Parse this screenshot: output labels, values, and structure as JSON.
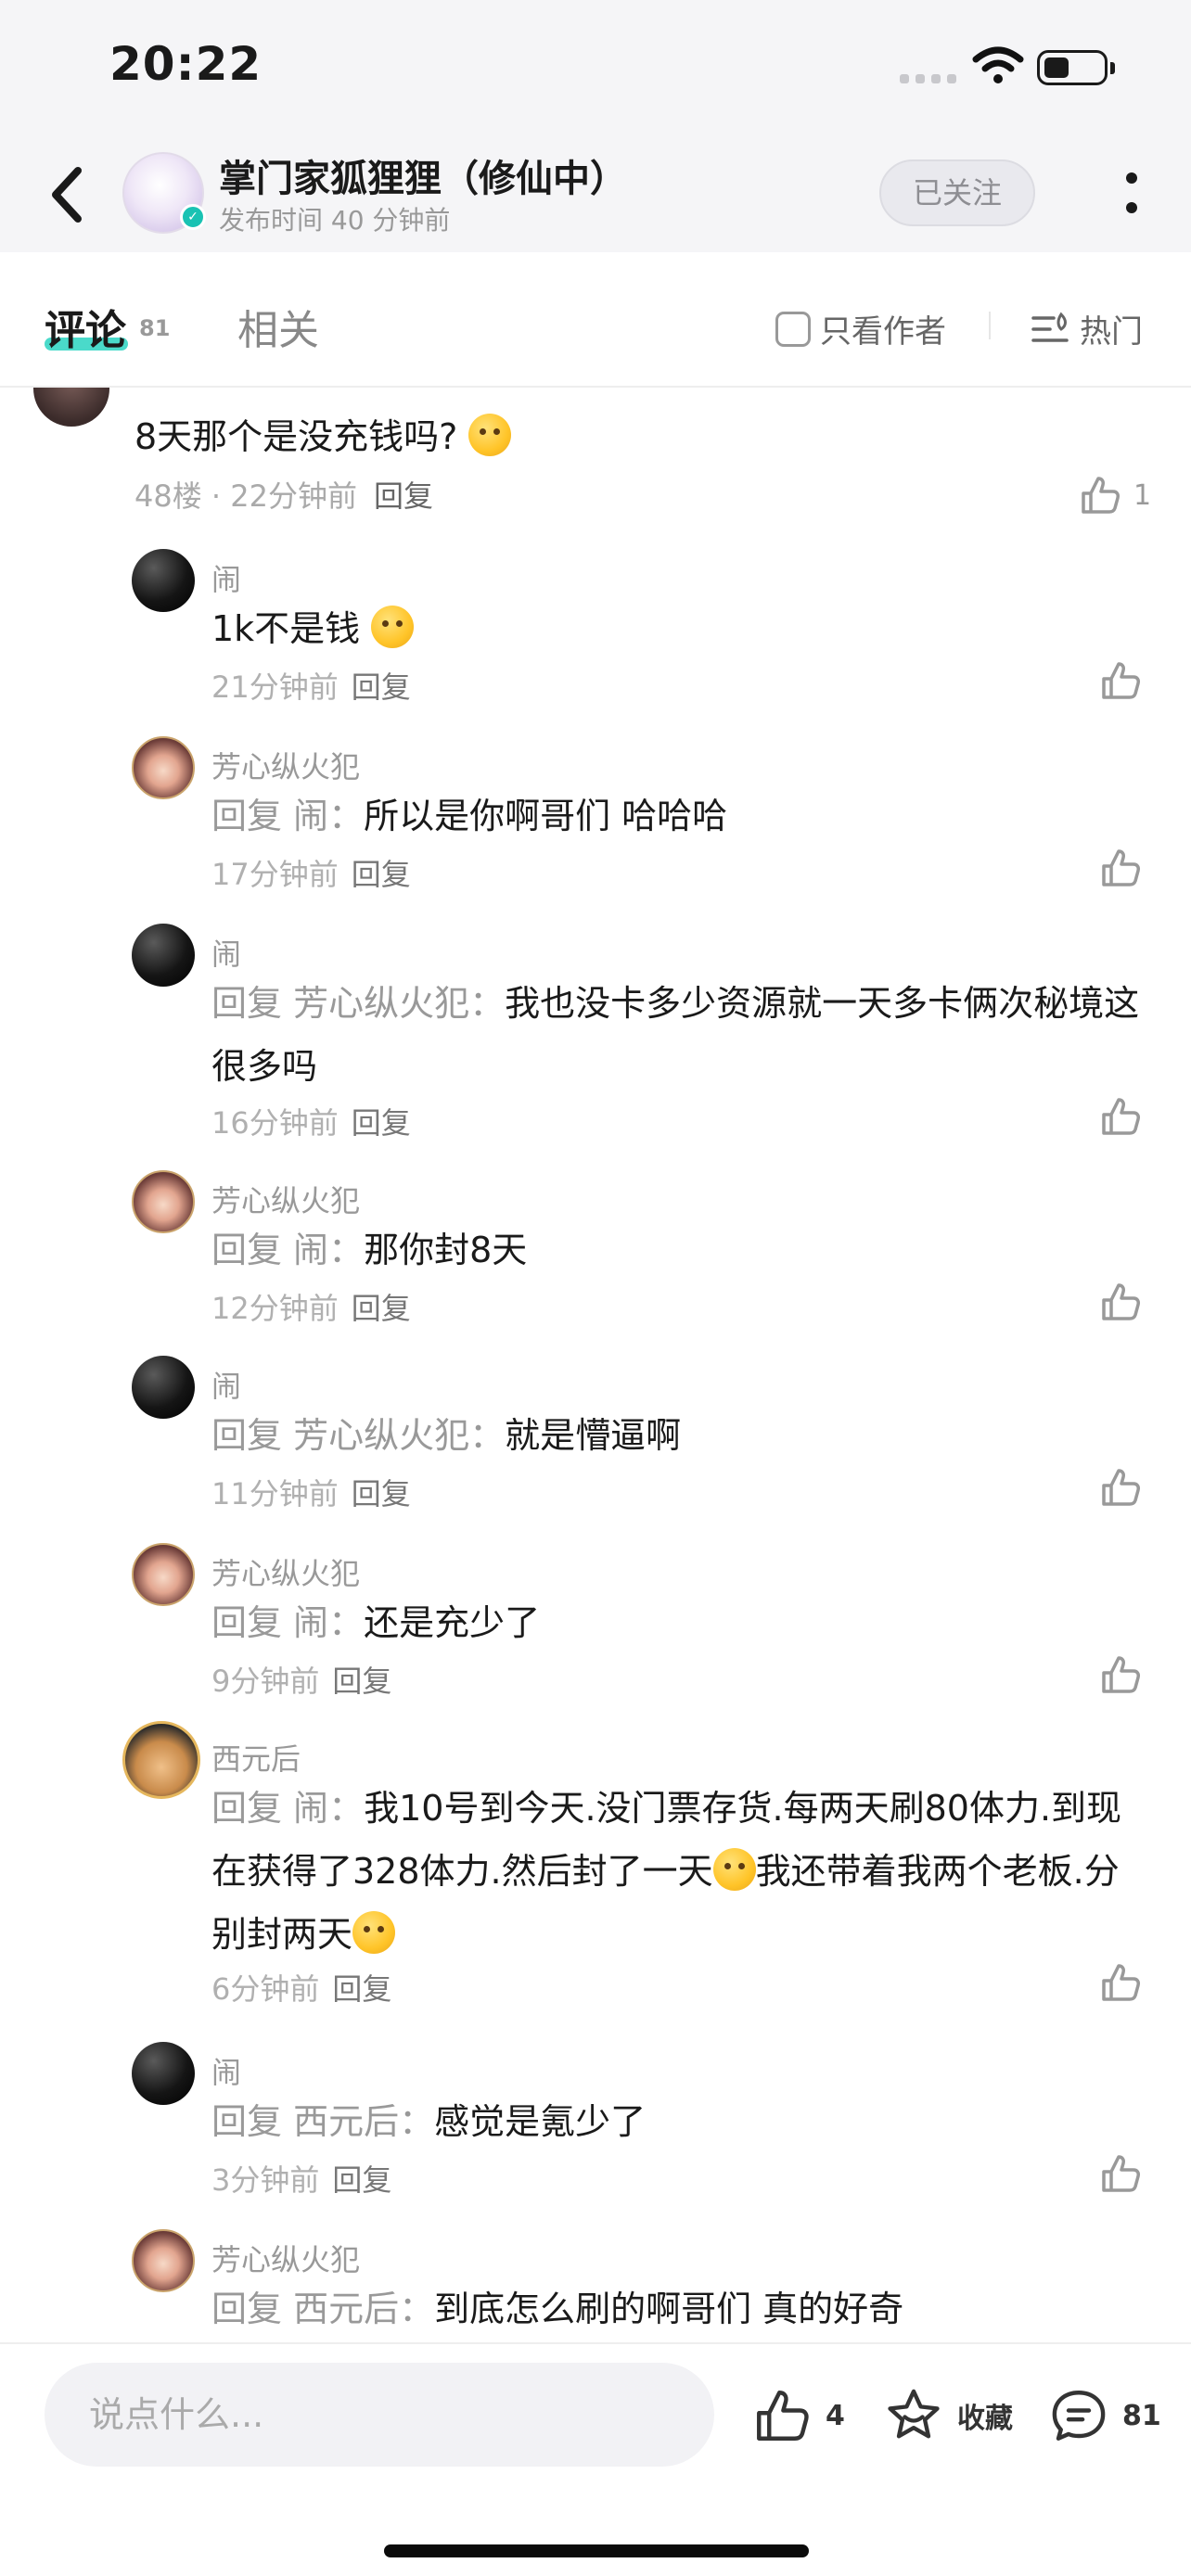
{
  "status_bar": {
    "time": "20:22"
  },
  "header": {
    "title": "掌门家狐狸狸（修仙中）",
    "subtitle": "发布时间 40 分钟前",
    "follow_label": "已关注"
  },
  "tabs": {
    "comments_label": "评论",
    "comments_count": "81",
    "related_label": "相关",
    "only_author_label": "只看作者",
    "sort_label": "热门"
  },
  "top_comment": {
    "text": "8天那个是没充钱吗?",
    "floor_time": "48楼 · 22分钟前",
    "reply_label": "回复",
    "like_count": "1"
  },
  "replies": [
    {
      "name": "闹",
      "prefix": "",
      "text": "1k不是钱",
      "time": "21分钟前",
      "reply_label": "回复"
    },
    {
      "name": "芳心纵火犯",
      "prefix": "回复 闹：",
      "text": "所以是你啊哥们 哈哈哈",
      "time": "17分钟前",
      "reply_label": "回复"
    },
    {
      "name": "闹",
      "prefix": "回复 芳心纵火犯：",
      "text": "我也没卡多少资源就一天多卡俩次秘境这很多吗",
      "time": "16分钟前",
      "reply_label": "回复"
    },
    {
      "name": "芳心纵火犯",
      "prefix": "回复 闹：",
      "text": "那你封8天",
      "time": "12分钟前",
      "reply_label": "回复"
    },
    {
      "name": "闹",
      "prefix": "回复 芳心纵火犯：",
      "text": "就是懵逼啊",
      "time": "11分钟前",
      "reply_label": "回复"
    },
    {
      "name": "芳心纵火犯",
      "prefix": "回复 闹：",
      "text": "还是充少了",
      "time": "9分钟前",
      "reply_label": "回复"
    },
    {
      "name": "西元后",
      "prefix": "回复 闹：",
      "text": "我10号到今天.没门票存货.每两天刷80体力.到现在获得了328体力.然后封了一天",
      "text_2": "我还带着我两个老板.分别封两天",
      "time": "6分钟前",
      "reply_label": "回复"
    },
    {
      "name": "闹",
      "prefix": "回复 西元后：",
      "text": "感觉是氪少了",
      "time": "3分钟前",
      "reply_label": "回复"
    },
    {
      "name": "芳心纵火犯",
      "prefix": "回复 西元后：",
      "text": "到底怎么刷的啊哥们 真的好奇",
      "time": "",
      "reply_label": ""
    }
  ],
  "bottom_bar": {
    "input_placeholder": "说点什么...",
    "like_count": "4",
    "collect_label": "收藏",
    "comment_count": "81"
  }
}
